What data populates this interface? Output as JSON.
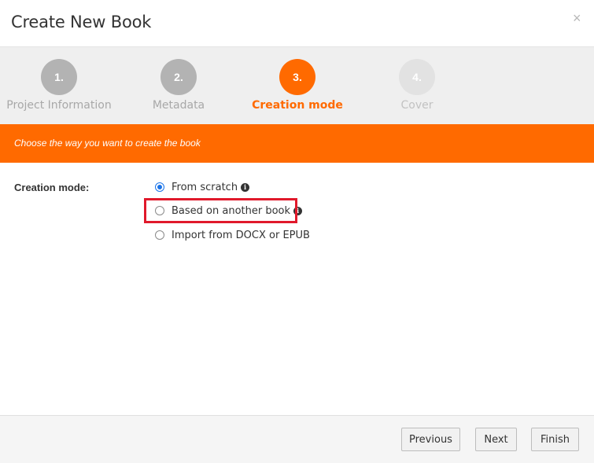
{
  "dialog": {
    "title": "Create New Book",
    "close_glyph": "×"
  },
  "steps": [
    {
      "number": "1.",
      "label": "Project Information",
      "state": "done"
    },
    {
      "number": "2.",
      "label": "Metadata",
      "state": "done"
    },
    {
      "number": "3.",
      "label": "Creation mode",
      "state": "active"
    },
    {
      "number": "4.",
      "label": "Cover",
      "state": "todo"
    }
  ],
  "banner": {
    "text": "Choose the way you want to create the book"
  },
  "form": {
    "label": "Creation mode:",
    "options": [
      {
        "label": "From scratch",
        "checked": true,
        "info": true
      },
      {
        "label": "Based on another book",
        "checked": false,
        "info": true,
        "highlighted": true
      },
      {
        "label": "Import from DOCX or EPUB",
        "checked": false,
        "info": false
      }
    ]
  },
  "footer": {
    "previous_label": "Previous",
    "next_label": "Next",
    "finish_label": "Finish"
  },
  "colors": {
    "accent": "#ff6a00",
    "highlight_box": "#e0192b",
    "radio_selected": "#1a73e8"
  },
  "icons": {
    "info": "info-circle-icon",
    "close": "close-icon"
  }
}
